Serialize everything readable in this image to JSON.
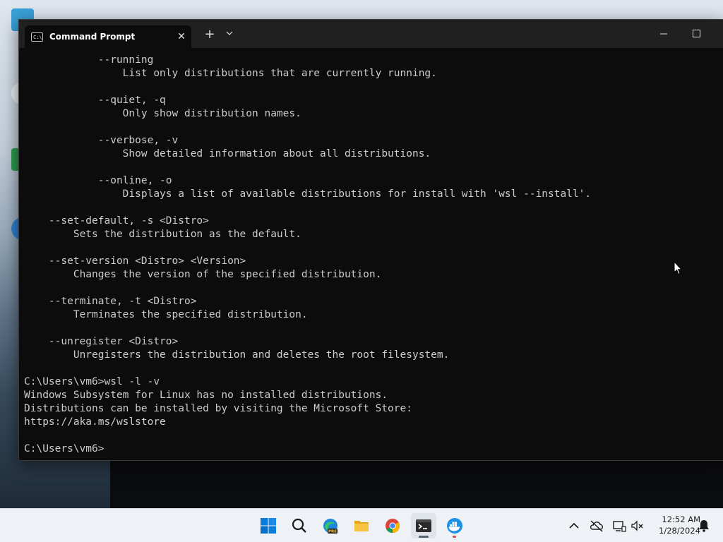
{
  "window": {
    "tab_title": "Command Prompt",
    "tab_icon_text": "C:\\",
    "close_tab_label": "✕",
    "new_tab_label": "+",
    "dropdown_label": "⌄",
    "minimize_label": "—"
  },
  "console_lines": [
    "            --running",
    "                List only distributions that are currently running.",
    "",
    "            --quiet, -q",
    "                Only show distribution names.",
    "",
    "            --verbose, -v",
    "                Show detailed information about all distributions.",
    "",
    "            --online, -o",
    "                Displays a list of available distributions for install with 'wsl --install'.",
    "",
    "    --set-default, -s <Distro>",
    "        Sets the distribution as the default.",
    "",
    "    --set-version <Distro> <Version>",
    "        Changes the version of the specified distribution.",
    "",
    "    --terminate, -t <Distro>",
    "        Terminates the specified distribution.",
    "",
    "    --unregister <Distro>",
    "        Unregisters the distribution and deletes the root filesystem.",
    "",
    "C:\\Users\\vm6>wsl -l -v",
    "Windows Subsystem for Linux has no installed distributions.",
    "Distributions can be installed by visiting the Microsoft Store:",
    "https://aka.ms/wslstore",
    "",
    "C:\\Users\\vm6>"
  ],
  "taskbar": {
    "items": [
      {
        "name": "start-button",
        "icon": "windows-logo-icon"
      },
      {
        "name": "search-button",
        "icon": "search-icon"
      },
      {
        "name": "edge-preview-button",
        "icon": "edge-icon",
        "badge": "PRE"
      },
      {
        "name": "file-explorer-button",
        "icon": "folder-icon"
      },
      {
        "name": "chrome-button",
        "icon": "chrome-icon"
      },
      {
        "name": "terminal-button",
        "icon": "terminal-icon"
      },
      {
        "name": "docker-button",
        "icon": "docker-icon"
      }
    ],
    "clock": {
      "time": "12:52 AM",
      "date": "1/28/2024"
    }
  },
  "colors": {
    "console_bg": "#0c0c0c",
    "console_text": "#cccccc",
    "titlebar_bg": "#202020",
    "taskbar_bg": "#eef2f6",
    "accent_blue": "#0078d4"
  }
}
